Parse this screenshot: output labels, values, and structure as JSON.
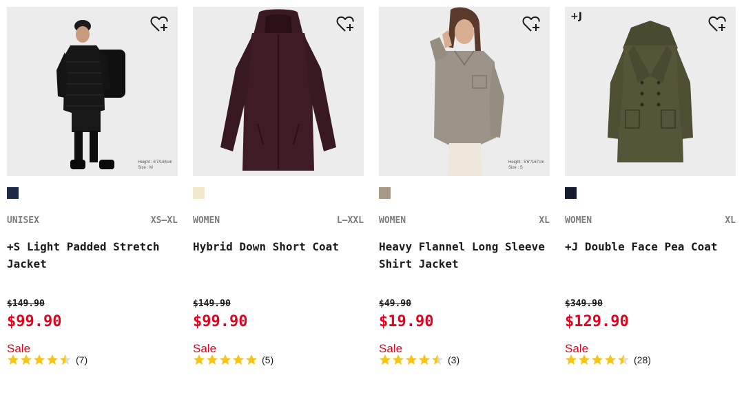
{
  "colors": {
    "sale_red": "#e6001e",
    "star_gold": "#f5c518",
    "text_dark": "#1b1b1b",
    "text_gray": "#7d7d7d",
    "image_bg": "#ececec"
  },
  "products": [
    {
      "brand_tag": "",
      "favorite_icon": "heart-plus-icon",
      "model_note_1": "Height : 6'7/184cm",
      "model_note_2": "Size : M",
      "swatch_color": "#1e2a45",
      "gender": "UNISEX",
      "size_range": "XS–XL",
      "title": "+S Light Padded Stretch Jacket",
      "original_price": "$149.90",
      "price": "$99.90",
      "flag": "Sale",
      "rating": 4.5,
      "review_count": "(7)"
    },
    {
      "brand_tag": "",
      "favorite_icon": "heart-plus-icon",
      "model_note_1": "",
      "model_note_2": "",
      "swatch_color": "#f4e8cc",
      "gender": "WOMEN",
      "size_range": "L–XXL",
      "title": "Hybrid Down Short Coat",
      "original_price": "$149.90",
      "price": "$99.90",
      "flag": "Sale",
      "rating": 5,
      "review_count": "(5)"
    },
    {
      "brand_tag": "",
      "favorite_icon": "heart-plus-icon",
      "model_note_1": "Height : 5'6\"/167cm",
      "model_note_2": "Size : S",
      "swatch_color": "#a89888",
      "gender": "WOMEN",
      "size_range": "XL",
      "title": "Heavy Flannel Long Sleeve Shirt Jacket",
      "original_price": "$49.90",
      "price": "$19.90",
      "flag": "Sale",
      "rating": 4.5,
      "review_count": "(3)"
    },
    {
      "brand_tag": "+J",
      "favorite_icon": "heart-plus-icon",
      "model_note_1": "",
      "model_note_2": "",
      "swatch_color": "#161b2e",
      "gender": "WOMEN",
      "size_range": "XL",
      "title": "+J Double Face Pea Coat",
      "original_price": "$349.90",
      "price": "$129.90",
      "flag": "Sale",
      "rating": 4.5,
      "review_count": "(28)"
    }
  ]
}
